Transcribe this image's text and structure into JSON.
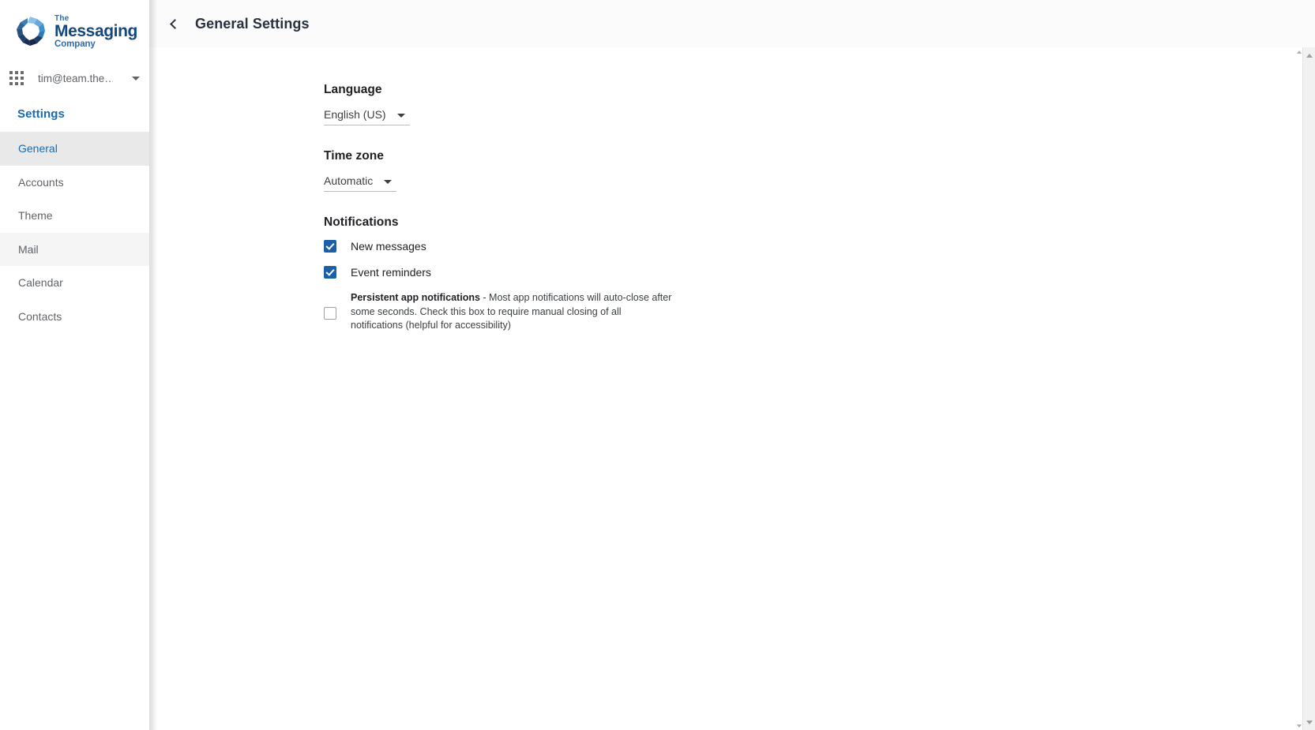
{
  "sidebar": {
    "brand": {
      "logo_icon": "messaging-company-logo-icon",
      "line_the": "The",
      "line_messaging": "Messaging",
      "line_company": "Company",
      "colors": {
        "dark": "#14477c",
        "mid": "#2f6ca8",
        "light": "#6aaede"
      }
    },
    "account": {
      "apps_icon": "apps-grid-icon",
      "email": "tim@team.the…",
      "caret_icon": "chevron-down-icon"
    },
    "settings_heading": "Settings",
    "items": [
      {
        "label": "General",
        "state": "selected"
      },
      {
        "label": "Accounts",
        "state": "normal"
      },
      {
        "label": "Theme",
        "state": "normal"
      },
      {
        "label": "Mail",
        "state": "hovered"
      },
      {
        "label": "Calendar",
        "state": "normal"
      },
      {
        "label": "Contacts",
        "state": "normal"
      }
    ],
    "selected_color": "#1a6aad"
  },
  "topbar": {
    "back_icon": "chevron-left-icon",
    "title": "General Settings"
  },
  "content": {
    "language": {
      "label": "Language",
      "selected": "English (US)",
      "caret_icon": "chevron-down-icon"
    },
    "timezone": {
      "label": "Time zone",
      "selected": "Automatic",
      "caret_icon": "chevron-down-icon"
    },
    "notifications": {
      "label": "Notifications",
      "items": [
        {
          "label": "New messages",
          "checked": true
        },
        {
          "label": "Event reminders",
          "checked": true
        }
      ],
      "persistent": {
        "checked": false,
        "title": "Persistent app notifications",
        "body": " - Most app notifications will auto-close after some seconds. Check this box to require manual closing of all notifications (helpful for accessibility)"
      },
      "checkbox_color": "#1a5fa8"
    }
  },
  "scrollbar": {
    "up_icon": "scroll-up-arrow-icon",
    "down_icon": "scroll-down-arrow-icon"
  }
}
